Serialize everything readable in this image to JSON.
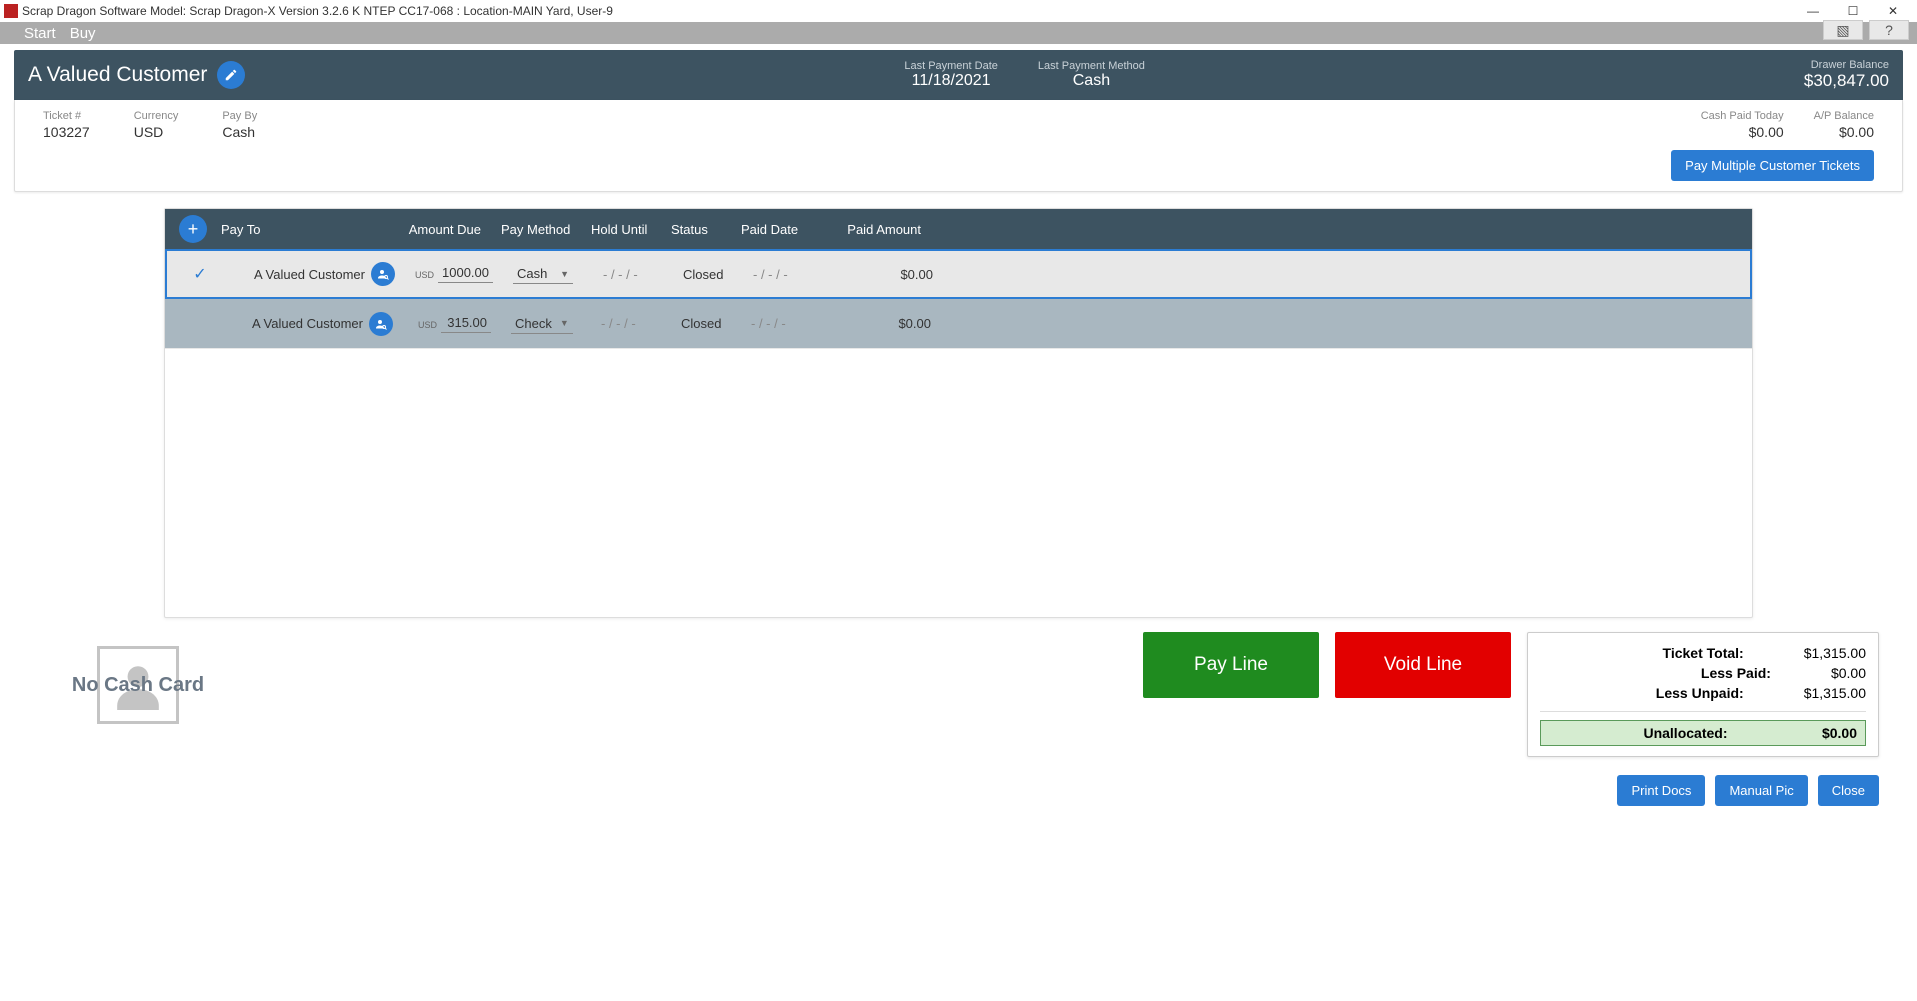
{
  "title": "Scrap Dragon Software Model: Scrap Dragon-X Version 3.2.6 K NTEP CC17-068 : Location-MAIN Yard, User-9",
  "menu": {
    "start": "Start",
    "buy": "Buy",
    "help": "?"
  },
  "customer": {
    "name": "A Valued Customer",
    "last_payment_date_lbl": "Last Payment Date",
    "last_payment_date": "11/18/2021",
    "last_payment_method_lbl": "Last Payment Method",
    "last_payment_method": "Cash",
    "drawer_balance_lbl": "Drawer Balance",
    "drawer_balance": "$30,847.00"
  },
  "ticket": {
    "ticket_lbl": "Ticket #",
    "ticket_no": "103227",
    "currency_lbl": "Currency",
    "currency": "USD",
    "payby_lbl": "Pay By",
    "payby": "Cash",
    "cash_paid_lbl": "Cash Paid Today",
    "cash_paid": "$0.00",
    "ap_lbl": "A/P Balance",
    "ap": "$0.00",
    "paymulti_btn": "Pay Multiple Customer Tickets"
  },
  "grid": {
    "headers": {
      "payto": "Pay To",
      "amount": "Amount Due",
      "method": "Pay Method",
      "hold": "Hold Until",
      "status": "Status",
      "pdate": "Paid Date",
      "pamt": "Paid Amount"
    },
    "rows": [
      {
        "selected": true,
        "payto": "A Valued Customer",
        "currency": "USD",
        "amount": "1000.00",
        "method": "Cash",
        "hold": "- / - / -",
        "status": "Closed",
        "pdate": "- / - / -",
        "pamt": "$0.00"
      },
      {
        "selected": false,
        "payto": "A Valued Customer",
        "currency": "USD",
        "amount": "315.00",
        "method": "Check",
        "hold": "- / - / -",
        "status": "Closed",
        "pdate": "- / - / -",
        "pamt": "$0.00"
      }
    ]
  },
  "no_cash_card": "No Cash Card",
  "actions": {
    "pay_line": "Pay Line",
    "void_line": "Void Line"
  },
  "totals": {
    "ticket_total_lbl": "Ticket Total:",
    "ticket_total": "$1,315.00",
    "less_paid_lbl": "Less Paid:",
    "less_paid": "$0.00",
    "less_unpaid_lbl": "Less Unpaid:",
    "less_unpaid": "$1,315.00",
    "unallocated_lbl": "Unallocated:",
    "unallocated": "$0.00"
  },
  "footer": {
    "print": "Print Docs",
    "manual": "Manual Pic",
    "close": "Close"
  }
}
